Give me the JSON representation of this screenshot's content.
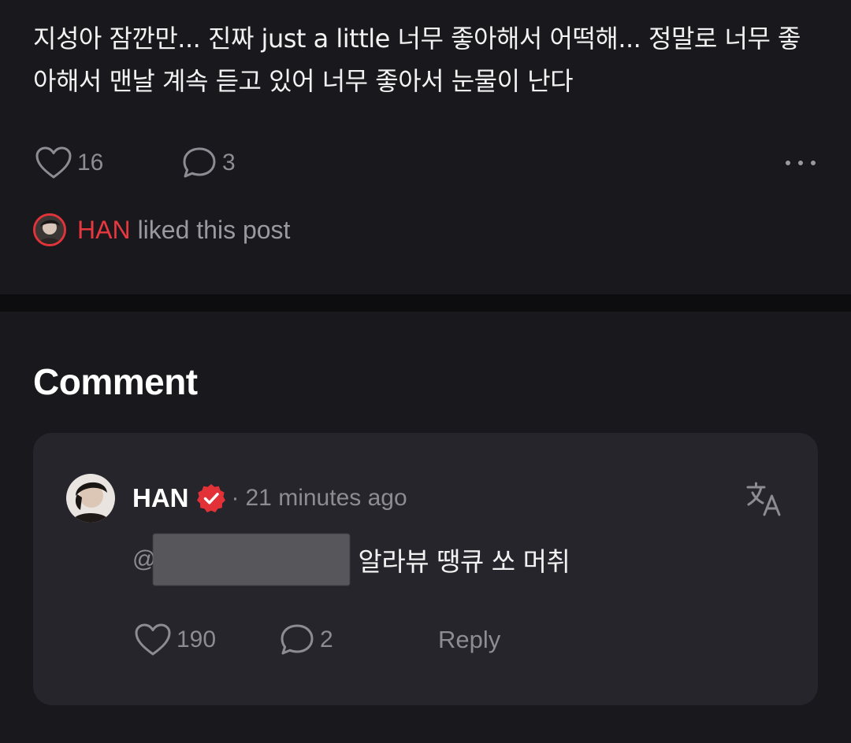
{
  "post": {
    "body": "지성아 잠깐만... 진짜 just a little  너무 좋아해서 어떡해... 정말로 너무 좋아해서 맨날 계속 듣고 있어 너무 좋아서 눈물이 난다",
    "like_count": "16",
    "comment_count": "3",
    "liked_by": {
      "name": "HAN",
      "suffix": "liked this post"
    }
  },
  "comments": {
    "heading": "Comment",
    "items": [
      {
        "author": "HAN",
        "verified": true,
        "time": "21 minutes ago",
        "mention_prefix": "@",
        "message": "알라뷰 땡큐 쏘 머취",
        "like_count": "190",
        "reply_count": "2",
        "reply_label": "Reply"
      }
    ]
  },
  "icons": {
    "like": "heart-outline-icon",
    "comment": "speech-bubble-icon",
    "more": "more-dots-icon",
    "translate": "translate-icon",
    "verified": "verified-badge-icon"
  },
  "colors": {
    "background": "#19181c",
    "card": "#26252c",
    "accent_red": "#e8383f",
    "muted_text": "#8d8c92"
  }
}
